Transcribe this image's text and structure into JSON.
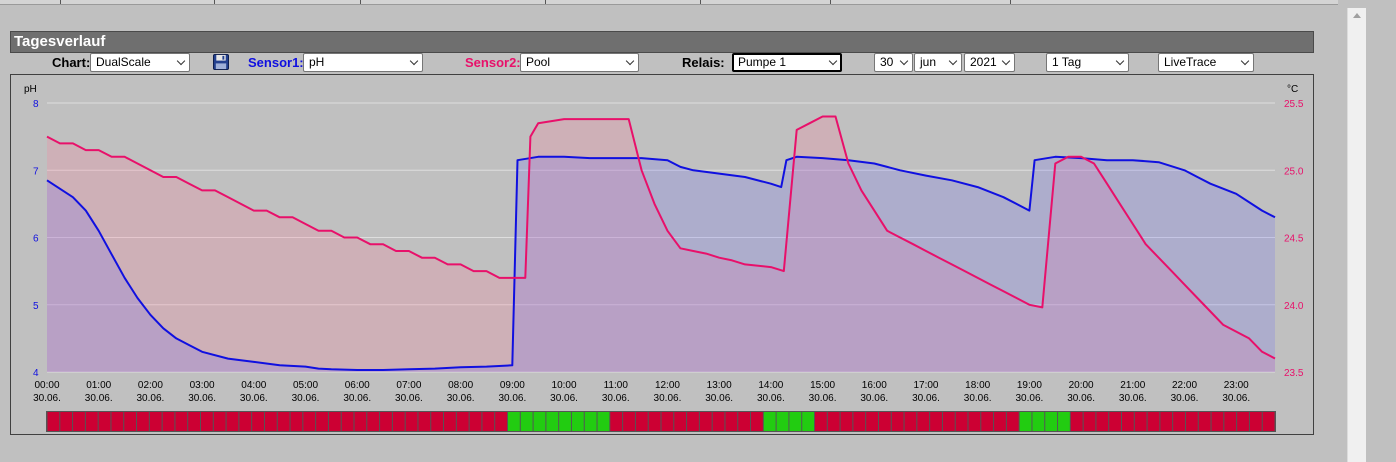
{
  "panel": {
    "title": "Tagesverlauf"
  },
  "controls": {
    "chart_label": "Chart:",
    "chart_value": "DualScale",
    "save_icon": "floppy-disk-icon",
    "sensor1_label": "Sensor1:",
    "sensor1_value": "pH",
    "sensor2_label": "Sensor2:",
    "sensor2_value": "Pool",
    "relais_label": "Relais:",
    "relais_value": "Pumpe 1",
    "day": "30",
    "month": "jun",
    "year": "2021",
    "range": "1 Tag",
    "mode": "LiveTrace"
  },
  "colors": {
    "sensor1": "#1010e0",
    "sensor2": "#e8106a",
    "relay_on": "#22cc11",
    "relay_off": "#cc0033"
  },
  "chart_data": {
    "type": "line",
    "left_axis": {
      "unit": "pH",
      "range": [
        4,
        8
      ],
      "ticks": [
        "8",
        "7",
        "6",
        "5",
        "4"
      ]
    },
    "right_axis": {
      "unit": "°C",
      "range": [
        23.5,
        25.5
      ],
      "ticks": [
        "25.5",
        "25.0",
        "24.5",
        "24.0",
        "23.5"
      ]
    },
    "x_range": [
      0,
      23.75
    ],
    "x_ticks": [
      {
        "time": "00:00",
        "date": "30.06."
      },
      {
        "time": "01:00",
        "date": "30.06."
      },
      {
        "time": "02:00",
        "date": "30.06."
      },
      {
        "time": "03:00",
        "date": "30.06."
      },
      {
        "time": "04:00",
        "date": "30.06."
      },
      {
        "time": "05:00",
        "date": "30.06."
      },
      {
        "time": "06:00",
        "date": "30.06."
      },
      {
        "time": "07:00",
        "date": "30.06."
      },
      {
        "time": "08:00",
        "date": "30.06."
      },
      {
        "time": "09:00",
        "date": "30.06."
      },
      {
        "time": "10:00",
        "date": "30.06."
      },
      {
        "time": "11:00",
        "date": "30.06."
      },
      {
        "time": "12:00",
        "date": "30.06."
      },
      {
        "time": "13:00",
        "date": "30.06."
      },
      {
        "time": "14:00",
        "date": "30.06."
      },
      {
        "time": "15:00",
        "date": "30.06."
      },
      {
        "time": "16:00",
        "date": "30.06."
      },
      {
        "time": "17:00",
        "date": "30.06."
      },
      {
        "time": "18:00",
        "date": "30.06."
      },
      {
        "time": "19:00",
        "date": "30.06."
      },
      {
        "time": "20:00",
        "date": "30.06."
      },
      {
        "time": "21:00",
        "date": "30.06."
      },
      {
        "time": "22:00",
        "date": "30.06."
      },
      {
        "time": "23:00",
        "date": "30.06."
      }
    ],
    "grid": true,
    "series": [
      {
        "name": "pH",
        "axis": "left",
        "points": [
          [
            0,
            6.85
          ],
          [
            0.5,
            6.6
          ],
          [
            0.75,
            6.4
          ],
          [
            1,
            6.1
          ],
          [
            1.25,
            5.75
          ],
          [
            1.5,
            5.4
          ],
          [
            1.75,
            5.1
          ],
          [
            2,
            4.85
          ],
          [
            2.25,
            4.65
          ],
          [
            2.5,
            4.5
          ],
          [
            2.75,
            4.4
          ],
          [
            3,
            4.3
          ],
          [
            3.5,
            4.2
          ],
          [
            4,
            4.15
          ],
          [
            4.5,
            4.1
          ],
          [
            5,
            4.08
          ],
          [
            5.25,
            4.05
          ],
          [
            5.5,
            4.04
          ],
          [
            6,
            4.03
          ],
          [
            6.5,
            4.03
          ],
          [
            7,
            4.04
          ],
          [
            7.5,
            4.05
          ],
          [
            8,
            4.07
          ],
          [
            8.5,
            4.08
          ],
          [
            9,
            4.1
          ],
          [
            9.1,
            7.15
          ],
          [
            9.5,
            7.2
          ],
          [
            10,
            7.2
          ],
          [
            10.5,
            7.18
          ],
          [
            11,
            7.18
          ],
          [
            11.5,
            7.18
          ],
          [
            12,
            7.15
          ],
          [
            12.25,
            7.05
          ],
          [
            12.5,
            7.0
          ],
          [
            13,
            6.95
          ],
          [
            13.5,
            6.9
          ],
          [
            14,
            6.8
          ],
          [
            14.2,
            6.75
          ],
          [
            14.3,
            7.15
          ],
          [
            14.5,
            7.2
          ],
          [
            15,
            7.18
          ],
          [
            15.5,
            7.15
          ],
          [
            16,
            7.1
          ],
          [
            16.25,
            7.05
          ],
          [
            16.5,
            7.0
          ],
          [
            17,
            6.92
          ],
          [
            17.5,
            6.85
          ],
          [
            18,
            6.75
          ],
          [
            18.5,
            6.6
          ],
          [
            19,
            6.4
          ],
          [
            19.1,
            7.15
          ],
          [
            19.5,
            7.2
          ],
          [
            20,
            7.18
          ],
          [
            20.5,
            7.15
          ],
          [
            21,
            7.15
          ],
          [
            21.5,
            7.12
          ],
          [
            22,
            7.0
          ],
          [
            22.25,
            6.9
          ],
          [
            22.5,
            6.8
          ],
          [
            23,
            6.65
          ],
          [
            23.5,
            6.4
          ],
          [
            23.75,
            6.3
          ]
        ]
      },
      {
        "name": "Pool",
        "axis": "right",
        "points": [
          [
            0,
            25.25
          ],
          [
            0.25,
            25.2
          ],
          [
            0.5,
            25.2
          ],
          [
            0.75,
            25.15
          ],
          [
            1,
            25.15
          ],
          [
            1.25,
            25.1
          ],
          [
            1.5,
            25.1
          ],
          [
            1.75,
            25.05
          ],
          [
            2,
            25.0
          ],
          [
            2.25,
            24.95
          ],
          [
            2.5,
            24.95
          ],
          [
            2.75,
            24.9
          ],
          [
            3,
            24.85
          ],
          [
            3.25,
            24.85
          ],
          [
            3.5,
            24.8
          ],
          [
            3.75,
            24.75
          ],
          [
            4,
            24.7
          ],
          [
            4.25,
            24.7
          ],
          [
            4.5,
            24.65
          ],
          [
            4.75,
            24.65
          ],
          [
            5,
            24.6
          ],
          [
            5.25,
            24.55
          ],
          [
            5.5,
            24.55
          ],
          [
            5.75,
            24.5
          ],
          [
            6,
            24.5
          ],
          [
            6.25,
            24.45
          ],
          [
            6.5,
            24.45
          ],
          [
            6.75,
            24.4
          ],
          [
            7,
            24.4
          ],
          [
            7.25,
            24.35
          ],
          [
            7.5,
            24.35
          ],
          [
            7.75,
            24.3
          ],
          [
            8,
            24.3
          ],
          [
            8.25,
            24.25
          ],
          [
            8.5,
            24.25
          ],
          [
            8.75,
            24.2
          ],
          [
            9,
            24.2
          ],
          [
            9.25,
            24.2
          ],
          [
            9.35,
            25.25
          ],
          [
            9.5,
            25.35
          ],
          [
            10,
            25.38
          ],
          [
            10.5,
            25.38
          ],
          [
            11,
            25.38
          ],
          [
            11.25,
            25.38
          ],
          [
            11.5,
            25.0
          ],
          [
            11.75,
            24.75
          ],
          [
            12,
            24.55
          ],
          [
            12.25,
            24.42
          ],
          [
            12.5,
            24.4
          ],
          [
            12.75,
            24.38
          ],
          [
            13,
            24.35
          ],
          [
            13.25,
            24.33
          ],
          [
            13.5,
            24.3
          ],
          [
            14,
            24.28
          ],
          [
            14.25,
            24.25
          ],
          [
            14.5,
            25.3
          ],
          [
            14.75,
            25.35
          ],
          [
            15,
            25.4
          ],
          [
            15.25,
            25.4
          ],
          [
            15.5,
            25.05
          ],
          [
            15.75,
            24.85
          ],
          [
            16,
            24.7
          ],
          [
            16.25,
            24.55
          ],
          [
            16.5,
            24.5
          ],
          [
            16.75,
            24.45
          ],
          [
            17,
            24.4
          ],
          [
            17.25,
            24.35
          ],
          [
            17.5,
            24.3
          ],
          [
            17.75,
            24.25
          ],
          [
            18,
            24.2
          ],
          [
            18.25,
            24.15
          ],
          [
            18.5,
            24.1
          ],
          [
            18.75,
            24.05
          ],
          [
            19,
            24.0
          ],
          [
            19.25,
            23.98
          ],
          [
            19.5,
            25.05
          ],
          [
            19.75,
            25.1
          ],
          [
            20,
            25.1
          ],
          [
            20.25,
            25.05
          ],
          [
            20.5,
            24.9
          ],
          [
            20.75,
            24.75
          ],
          [
            21,
            24.6
          ],
          [
            21.25,
            24.45
          ],
          [
            21.5,
            24.35
          ],
          [
            21.75,
            24.25
          ],
          [
            22,
            24.15
          ],
          [
            22.25,
            24.05
          ],
          [
            22.5,
            23.95
          ],
          [
            22.75,
            23.85
          ],
          [
            23,
            23.8
          ],
          [
            23.25,
            23.75
          ],
          [
            23.5,
            23.65
          ],
          [
            23.75,
            23.6
          ]
        ]
      }
    ],
    "relay": {
      "name": "Pumpe 1",
      "on_intervals": [
        [
          9,
          11
        ],
        [
          14,
          15
        ],
        [
          19,
          20
        ]
      ]
    }
  }
}
